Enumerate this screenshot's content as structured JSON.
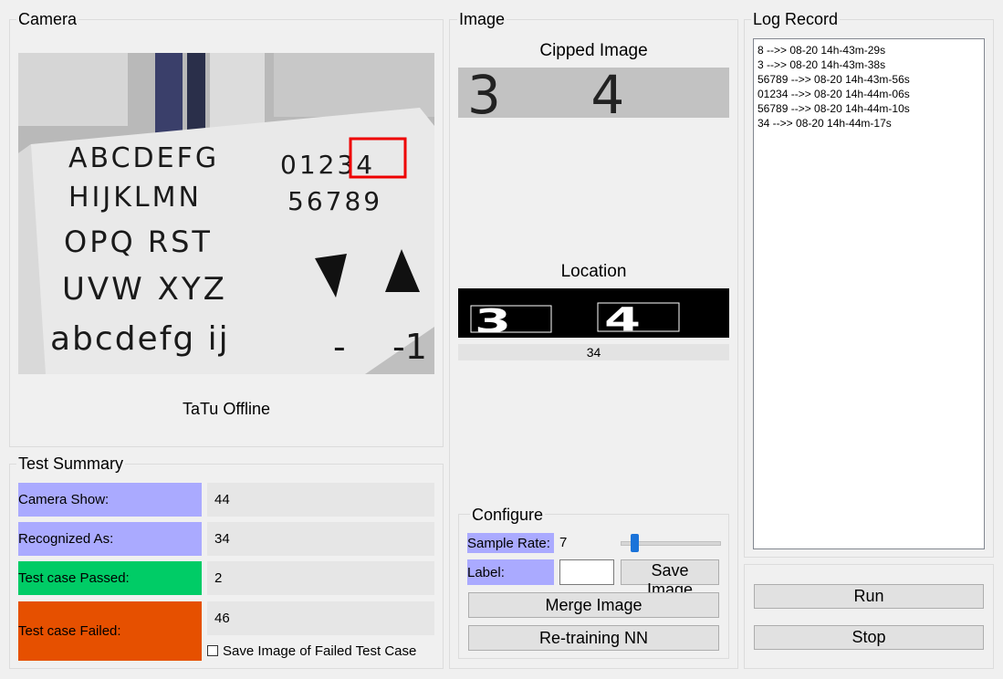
{
  "camera": {
    "title": "Camera",
    "status": "TaTu Offline",
    "sheet_lines": [
      "ABCDEFG",
      "01234",
      "HIJKLMN",
      "56789",
      "OPQ RST",
      "UVW XYZ",
      "abcdefg ij",
      "-",
      "-1"
    ]
  },
  "image": {
    "title": "Image",
    "clipped_title": "Cipped Image",
    "clipped_digits": "3 4",
    "location_title": "Location",
    "location_digits": [
      "3",
      "4"
    ],
    "result": "34"
  },
  "log": {
    "title": "Log Record",
    "entries": [
      "8 -->> 08-20 14h-43m-29s",
      "3 -->> 08-20 14h-43m-38s",
      "56789 -->> 08-20 14h-43m-56s",
      "01234 -->> 08-20 14h-44m-06s",
      "56789 -->> 08-20 14h-44m-10s",
      "34 -->> 08-20 14h-44m-17s"
    ]
  },
  "summary": {
    "title": "Test Summary",
    "camera_show_label": "Camera Show:",
    "camera_show_value": "44",
    "recognized_label": "Recognized As:",
    "recognized_value": "34",
    "passed_label": "Test case Passed:",
    "passed_value": "2",
    "failed_label": "Test case Failed:",
    "failed_value": "46",
    "save_failed_label": "Save Image of  Failed Test Case"
  },
  "configure": {
    "title": "Configure",
    "sample_rate_label": "Sample Rate:",
    "sample_rate_value": "7",
    "label_label": "Label:",
    "label_value": "",
    "save_image": "Save Image",
    "merge_image": "Merge Image",
    "retrain": "Re-training NN"
  },
  "controls": {
    "run": "Run",
    "stop": "Stop"
  },
  "colors": {
    "label_bg": "#aaaaff",
    "passed_bg": "#00cc66",
    "failed_bg": "#e65000",
    "highlight_box": "#ee0000",
    "slider_thumb": "#1a73d9"
  }
}
